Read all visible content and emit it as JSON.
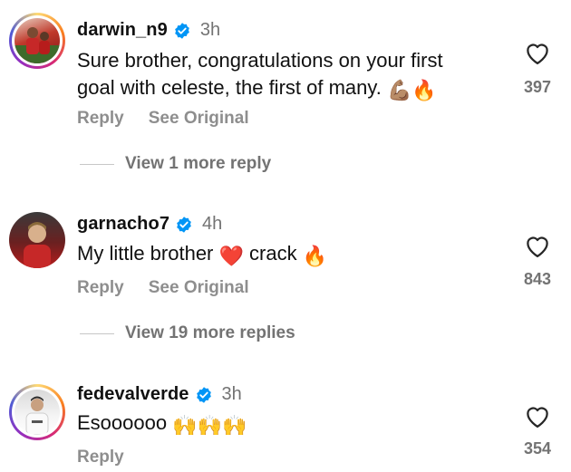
{
  "comments": [
    {
      "username": "darwin_n9",
      "time": "3h",
      "text_line1": "Sure brother, congratulations on your first",
      "text_line2": "goal with celeste, the first of many.",
      "emoji": "💪🏽🔥",
      "reply_label": "Reply",
      "see_original_label": "See Original",
      "likes": "397",
      "more_replies": "View 1 more reply",
      "verified": true,
      "avatar_colors": [
        "#c0392b",
        "#8b1a1a"
      ]
    },
    {
      "username": "garnacho7",
      "time": "4h",
      "text_before": "My little brother",
      "heart_emoji": "❤️",
      "text_after": "crack",
      "fire_emoji": "🔥",
      "reply_label": "Reply",
      "see_original_label": "See Original",
      "likes": "843",
      "more_replies": "View 19 more replies",
      "verified": true,
      "avatar_colors": [
        "#b71c1c",
        "#4a4a4a"
      ]
    },
    {
      "username": "fedevalverde",
      "time": "3h",
      "text": "Esoooooo",
      "emoji": "🙌🙌🙌",
      "reply_label": "Reply",
      "likes": "354",
      "verified": true,
      "avatar_colors": [
        "#e8e8e8",
        "#333333"
      ]
    }
  ],
  "colors": {
    "verified_blue": "#0095f6",
    "muted_text": "#737373",
    "heart_outline": "#262626"
  }
}
